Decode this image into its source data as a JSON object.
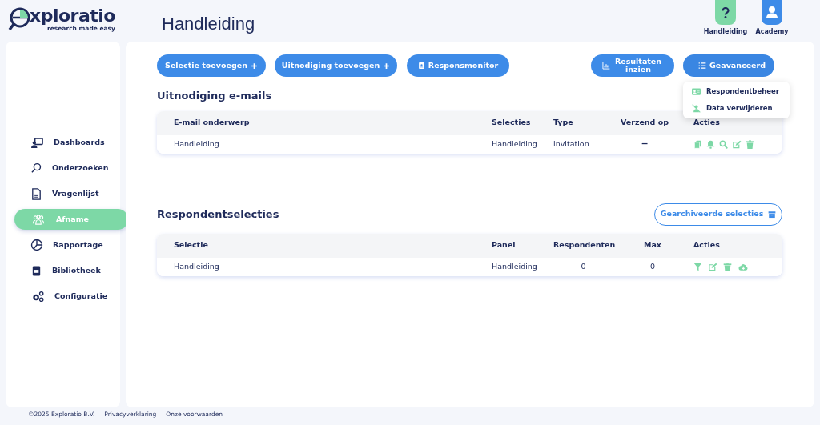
{
  "logo": {
    "name": "xploratio",
    "tagline": "research made easy"
  },
  "page_title": "Handleiding",
  "top_links": [
    {
      "label": "Handleiding",
      "kind": "help"
    },
    {
      "label": "Academy",
      "kind": "user"
    }
  ],
  "sidebar": {
    "items": [
      {
        "label": "Dashboards",
        "selected": false
      },
      {
        "label": "Onderzoeken",
        "selected": false
      },
      {
        "label": "Vragenlijst",
        "selected": false
      },
      {
        "label": "Afname",
        "selected": true
      },
      {
        "label": "Rapportage",
        "selected": false
      },
      {
        "label": "Bibliotheek",
        "selected": false
      },
      {
        "label": "Configuratie",
        "selected": false
      }
    ]
  },
  "toolbar": {
    "left": [
      {
        "label": "Selectie toevoegen",
        "kind": "add"
      },
      {
        "label": "Uitnodiging toevoegen",
        "kind": "add"
      },
      {
        "label": "Responsmonitor",
        "kind": "monitor"
      }
    ],
    "right": [
      {
        "label": "Resultaten inzien",
        "kind": "chart"
      },
      {
        "label": "Geavanceerd",
        "kind": "list",
        "expanded": true,
        "menu": [
          {
            "label": "Respondentbeheer",
            "kind": "card"
          },
          {
            "label": "Data verwijderen",
            "kind": "remove"
          }
        ]
      }
    ]
  },
  "invitations": {
    "title": "Uitnodiging e-mails",
    "columns": [
      "E-mail onderwerp",
      "Selecties",
      "Type",
      "Verzend op",
      "Acties"
    ],
    "rows": [
      {
        "subject": "Handleiding",
        "selections": "Handleiding",
        "type": "invitation",
        "send_on": "−"
      }
    ]
  },
  "selections": {
    "title": "Respondentselecties",
    "archive_button": "Gearchiveerde selecties",
    "columns": [
      "Selectie",
      "Panel",
      "Respondenten",
      "Max",
      "Acties"
    ],
    "rows": [
      {
        "selection": "Handleiding",
        "panel": "Handleiding",
        "respondents": "0",
        "max": "0"
      }
    ]
  },
  "footer": [
    "©2025 Exploratio B.V.",
    "Privacyverklaring",
    "Onze voorwaarden"
  ]
}
